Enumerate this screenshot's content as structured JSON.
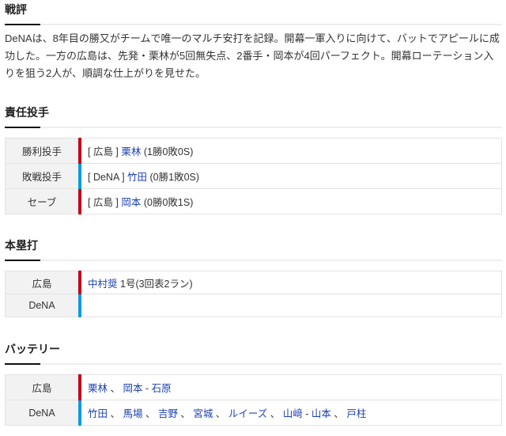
{
  "review": {
    "title": "戦評",
    "text": "DeNAは、8年目の勝又がチームで唯一のマルチ安打を記録。開幕一軍入りに向けて、バットでアピールに成功した。一方の広島は、先発・栗林が5回無失点、2番手・岡本が4回パーフェクト。開幕ローテーション入りを狙う2人が、順調な仕上がりを見せた。"
  },
  "pitchers": {
    "title": "責任投手",
    "rows": [
      {
        "label": "勝利投手",
        "team": "[ 広島 ]",
        "name": "栗林",
        "record": "(1勝0敗0S)",
        "side": "carp"
      },
      {
        "label": "敗戦投手",
        "team": "[ DeNA ]",
        "name": "竹田",
        "record": "(0勝1敗0S)",
        "side": "dena"
      },
      {
        "label": "セーブ",
        "team": "[ 広島 ]",
        "name": "岡本",
        "record": "(0勝0敗1S)",
        "side": "carp"
      }
    ]
  },
  "homeruns": {
    "title": "本塁打",
    "rows": [
      {
        "label": "広島",
        "name": "中村奨",
        "detail": "1号(3回表2ラン)"
      },
      {
        "label": "DeNA",
        "name": "",
        "detail": ""
      }
    ]
  },
  "battery": {
    "title": "バッテリー",
    "rows": [
      {
        "label": "広島",
        "pitchers": [
          "栗林",
          "岡本"
        ],
        "catchers": [
          "石原"
        ]
      },
      {
        "label": "DeNA",
        "pitchers": [
          "竹田",
          "馬場",
          "吉野",
          "宮城",
          "ルイーズ",
          "山﨑"
        ],
        "catchers": [
          "山本",
          "戸柱"
        ]
      }
    ]
  },
  "colors": {
    "carp": "#c4001a",
    "dena": "#0a9be0",
    "link": "#1a3fb5"
  }
}
